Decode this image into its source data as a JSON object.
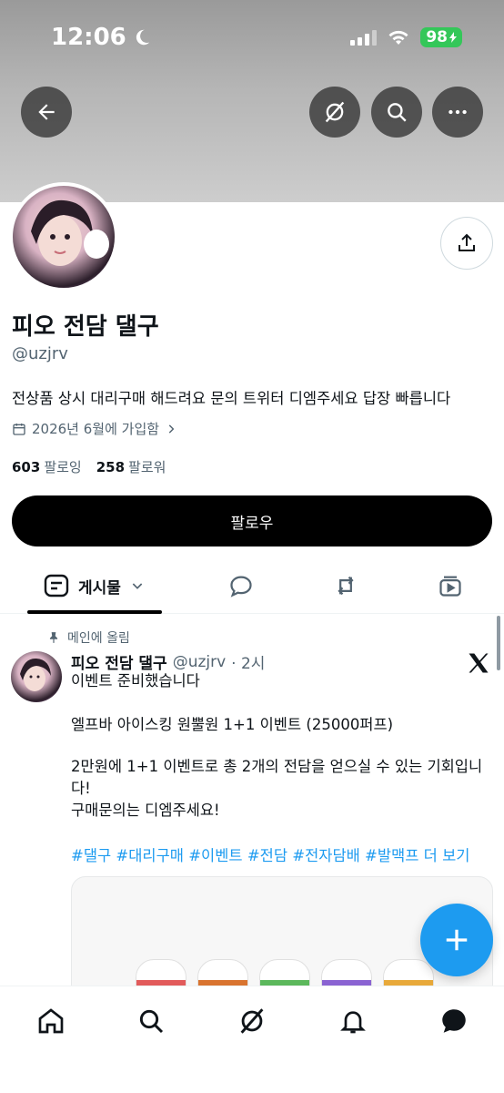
{
  "status_bar": {
    "time": "12:06",
    "battery": "98"
  },
  "profile": {
    "display_name": "피오 전담 댈구",
    "handle": "@uzjrv",
    "bio": "전상품 상시 대리구매 해드려요 문의 트위터 디엠주세요 답장 빠릅니다",
    "joined": "2026년 6월에 가입함",
    "following_count": "603",
    "following_label": "팔로잉",
    "followers_count": "258",
    "followers_label": "팔로워",
    "follow_button": "팔로우"
  },
  "tabs": {
    "posts_label": "게시물"
  },
  "pinned_post": {
    "pinned_label": "메인에 올림",
    "author_name": "피오 전담 댈구",
    "author_handle": "@uzjrv",
    "time": "· 2시",
    "line1": "이벤트 준비했습니다",
    "line2": "엘프바 아이스킹 원뿔원 1+1 이벤트 (25000퍼프)",
    "line3": "2만원에 1+1 이벤트로 총 2개의 전담을 얻으실 수 있는 기회입니",
    "line4": "다!",
    "line5": "구매문의는 디엠주세요!",
    "hashtags": "#댈구 #대리구매 #이벤트 #전담 #전자담배 #발맥프 더 보기"
  },
  "colors": {
    "accent": "#1d9bf0",
    "battery": "#34c759"
  },
  "icons": {
    "back": "arrow-left-icon",
    "grok": "grok-icon",
    "search": "search-icon",
    "more": "more-icon",
    "share": "share-icon",
    "calendar": "calendar-icon",
    "pin": "pin-icon",
    "x_logo": "x-logo-icon",
    "compose": "plus-icon"
  },
  "media": {
    "bottle_colors": [
      "#e25b5b",
      "#d9742f",
      "#5cb85c",
      "#8a63d2",
      "#e8a93a"
    ]
  }
}
